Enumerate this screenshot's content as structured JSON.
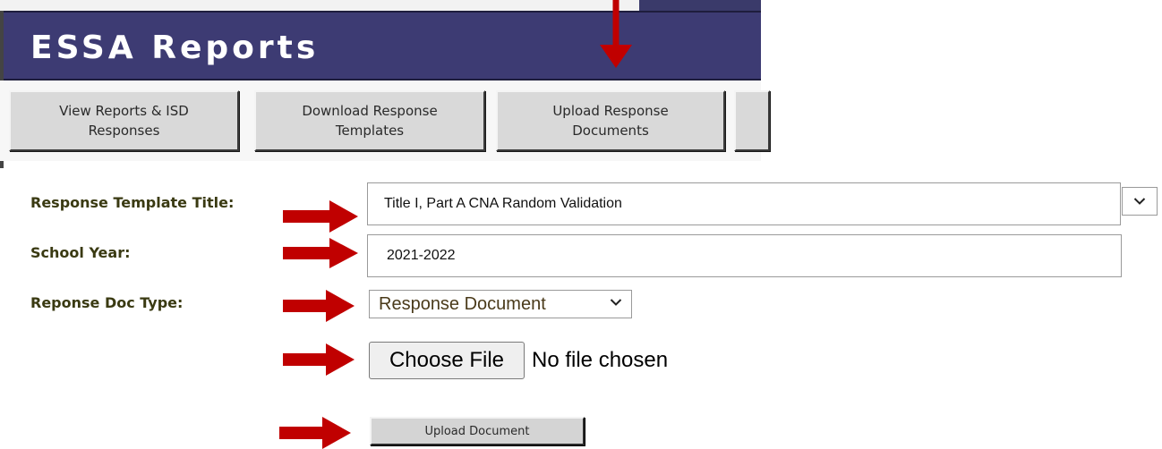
{
  "app": {
    "title": "ESSA Reports"
  },
  "tabs": [
    {
      "label": "View Reports & ISD\nResponses"
    },
    {
      "label": "Download Response\nTemplates"
    },
    {
      "label": "Upload Response\nDocuments"
    },
    {
      "label": ""
    }
  ],
  "form": {
    "template_title_label": "Response Template Title:",
    "template_title_value": "Title I, Part A CNA Random Validation",
    "school_year_label": "School Year:",
    "school_year_value": "2021-2022",
    "doc_type_label": "Reponse Doc Type:",
    "doc_type_value": "Response Document",
    "choose_file_label": "Choose File",
    "no_file_text": "No file chosen",
    "upload_label": "Upload Document"
  },
  "colors": {
    "banner": "#3d3b73",
    "arrow": "#c00000",
    "label": "#3a3a12",
    "tab_face": "#d9d9d9"
  },
  "icons": {
    "dropdown": "chevron-down-icon",
    "annotation": "red-arrow-icon"
  }
}
